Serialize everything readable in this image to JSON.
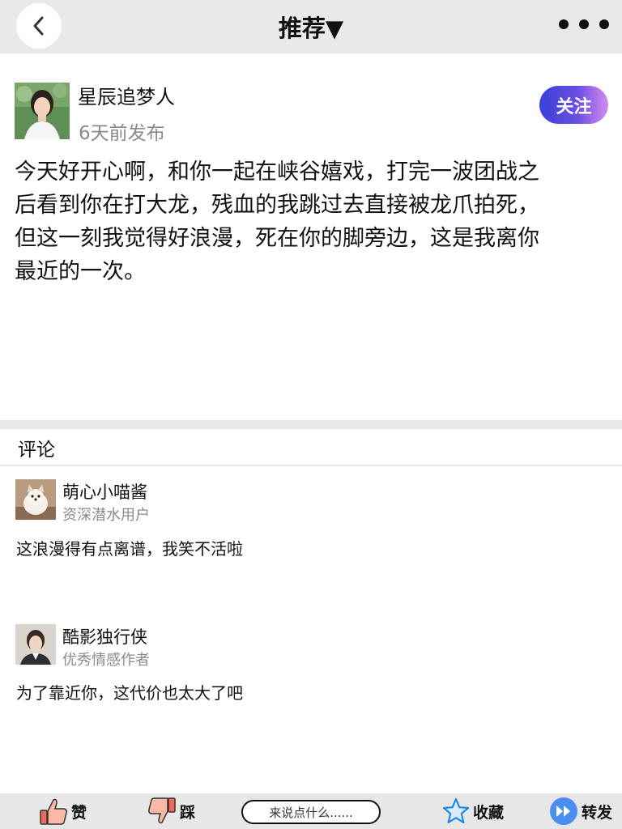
{
  "header": {
    "title": "推荐▼"
  },
  "post": {
    "author": "星辰追梦人",
    "time": "6天前发布",
    "follow_label": "关注",
    "lines": [
      "今天好开心啊，和你一起在峡谷嬉戏，打完一波团战之",
      "后看到你在打大龙，残血的我跳过去直接被龙爪拍死，",
      "但这一刻我觉得好浪漫，死在你的脚旁边，这是我离你",
      "最近的一次。"
    ]
  },
  "comments": {
    "title": "评论",
    "items": [
      {
        "user": "萌心小喵酱",
        "badge": "资深潜水用户",
        "text": "这浪漫得有点离谱，我笑不活啦"
      },
      {
        "user": "酷影独行侠",
        "badge": "优秀情感作者",
        "text": "为了靠近你，这代价也太大了吧"
      }
    ]
  },
  "bottom_bar": {
    "like_label": "赞",
    "dislike_label": "踩",
    "input_placeholder": "来说点什么......",
    "favorite_label": "收藏",
    "share_label": "转发"
  },
  "colors": {
    "top_bar_bg": "#e9e9e9",
    "follow_gradient_start": "#3a3fd8",
    "follow_gradient_end": "#d38bf2",
    "secondary_text": "#8a8a8a",
    "star_blue": "#1e88e5"
  }
}
